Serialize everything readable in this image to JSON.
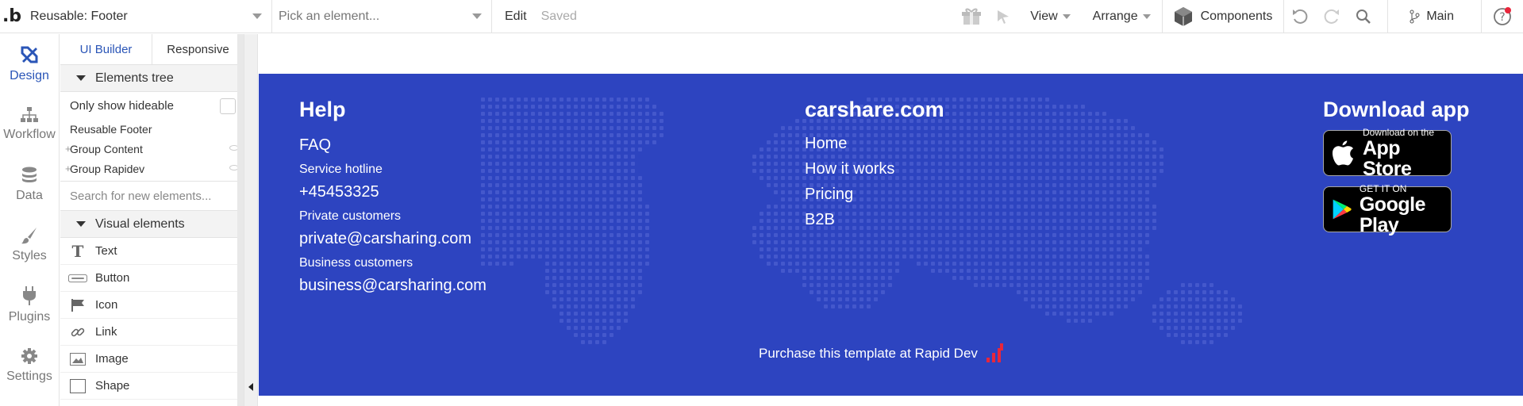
{
  "topbar": {
    "logo": ".b",
    "page_select": "Reusable: Footer",
    "element_picker_placeholder": "Pick an element...",
    "edit_label": "Edit",
    "saved_label": "Saved",
    "view_label": "View",
    "arrange_label": "Arrange",
    "components_label": "Components",
    "branch_label": "Main"
  },
  "leftnav": {
    "items": [
      {
        "label": "Design",
        "icon": "design-icon"
      },
      {
        "label": "Workflow",
        "icon": "workflow-icon"
      },
      {
        "label": "Data",
        "icon": "data-icon"
      },
      {
        "label": "Styles",
        "icon": "styles-icon"
      },
      {
        "label": "Plugins",
        "icon": "plugins-icon"
      },
      {
        "label": "Settings",
        "icon": "settings-icon"
      }
    ]
  },
  "panel": {
    "tabs": [
      "UI Builder",
      "Responsive"
    ],
    "elements_tree_title": "Elements tree",
    "only_show_hideable": "Only show hideable",
    "tree": [
      "Reusable Footer",
      "Group Content",
      "Group Rapidev"
    ],
    "search_placeholder": "Search for new elements...",
    "visual_elements_title": "Visual elements",
    "visual_elements": [
      "Text",
      "Button",
      "Icon",
      "Link",
      "Image",
      "Shape"
    ]
  },
  "footer": {
    "help": {
      "title": "Help",
      "faq": "FAQ",
      "service_hotline": "Service hotline",
      "phone": "+45453325",
      "private_customers": "Private customers",
      "private_email": "private@carsharing.com",
      "business_customers": "Business customers",
      "business_email": "business@carsharing.com"
    },
    "site": {
      "title": "carshare.com",
      "links": [
        "Home",
        "How it works",
        "Pricing",
        "B2B"
      ]
    },
    "app": {
      "title": "Download app",
      "appstore_small": "Download on the",
      "appstore_big": "App Store",
      "googleplay_small": "GET IT ON",
      "googleplay_big": "Google Play"
    },
    "purchase": "Purchase this template at Rapid Dev",
    "colors": {
      "background": "#2d44c0",
      "accent_red": "#e8263b"
    }
  }
}
